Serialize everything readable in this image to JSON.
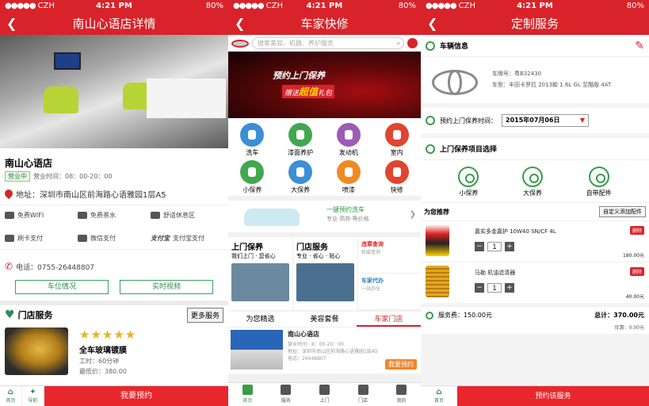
{
  "status": {
    "carrier": "CZH",
    "time": "4:21 PM",
    "battery": "80%"
  },
  "p1": {
    "title": "南山心语店详情",
    "shop_name": "南山心语店",
    "badge": "营业中",
    "hours": "营业时间：08：00-20：00",
    "address": "地址：深圳市南山区前海路心语雅园1层A5",
    "facilities": [
      "免费WIFI",
      "免费茶水",
      "舒适休息区",
      "刷卡支付",
      "微信支付",
      "支付宝支付"
    ],
    "alipay_logo": "支付宝",
    "phone": "电话：0755-26448807",
    "btn_parking": "车位情况",
    "btn_video": "实时视频",
    "section_title": "门店服务",
    "more": "更多服务",
    "service": {
      "stars": "★★★★★",
      "name": "全车玻璃镀膜",
      "duration": "工时：60分钟",
      "price": "最低价：380.00"
    },
    "nav_home": "首页",
    "nav_guide": "导航",
    "cta": "我要预约"
  },
  "p2": {
    "title": "车家快修",
    "search_placeholder": "搜索美容、机器、养护服务",
    "banner_line1": "预约上门保养",
    "banner_line2a": "赠送",
    "banner_line2b": "超值",
    "banner_line2c": "礼包",
    "grid": [
      {
        "label": "洗车",
        "color": "#3b8fd4"
      },
      {
        "label": "漆面养护",
        "color": "#41a84f"
      },
      {
        "label": "发动机",
        "color": "#9c5bb5"
      },
      {
        "label": "室内",
        "color": "#e0452f"
      },
      {
        "label": "小保养",
        "color": "#41a84f"
      },
      {
        "label": "大保养",
        "color": "#3b8fd4"
      },
      {
        "label": "喷漆",
        "color": "#f08a24"
      },
      {
        "label": "快修",
        "color": "#e0452f"
      }
    ],
    "promo_title": "一键预约洗车",
    "promo_sub": "专业·高效·等价格",
    "block1_title": "上门保养",
    "block1_sub": "我们上门 · 您省心",
    "block2_title": "门店服务",
    "block2_sub": "专业 · 省心 · 贴心",
    "side1": "违章查询",
    "side1_sub": "权威查询",
    "side2": "车家代办",
    "side2_sub": "一站办全",
    "tabs": [
      "为您精选",
      "美容套餐",
      "车家门店"
    ],
    "store": {
      "name": "南山心语店",
      "hours": "营业时间：8：00-20：00",
      "addr": "地址：深圳市南山区前海路心语雅园1层A5",
      "tel": "电话：26448807",
      "btn": "我要预约"
    },
    "tabbar": [
      "首页",
      "服务",
      "上门",
      "门店",
      "我的"
    ]
  },
  "p3": {
    "title": "定制服务",
    "vehicle_label": "车辆信息",
    "plate": "车牌号：粤B32430",
    "model": "车型：丰田卡罗拉 2013款 1.6L GL 至酷版 4AT",
    "time_label": "预约上门保养时间：",
    "date": "2015年07月06日",
    "items_label": "上门保养项目选择",
    "items": [
      "小保养",
      "大保养",
      "自带配件"
    ],
    "rec": "为您推荐",
    "add": "自定义添加配件",
    "products": [
      {
        "name": "嘉实多金嘉护 10W40 SN/CF 4L",
        "qty": "1",
        "price": "180.00元",
        "del": "删除"
      },
      {
        "name": "马勒 机油滤清器",
        "qty": "1",
        "price": "40.00元",
        "del": "删除"
      }
    ],
    "service_fee": "服务费：150.00元",
    "total": "总计：370.00元",
    "discount": "优惠：0.00元",
    "nav_home": "首页",
    "cta": "预约该服务"
  }
}
